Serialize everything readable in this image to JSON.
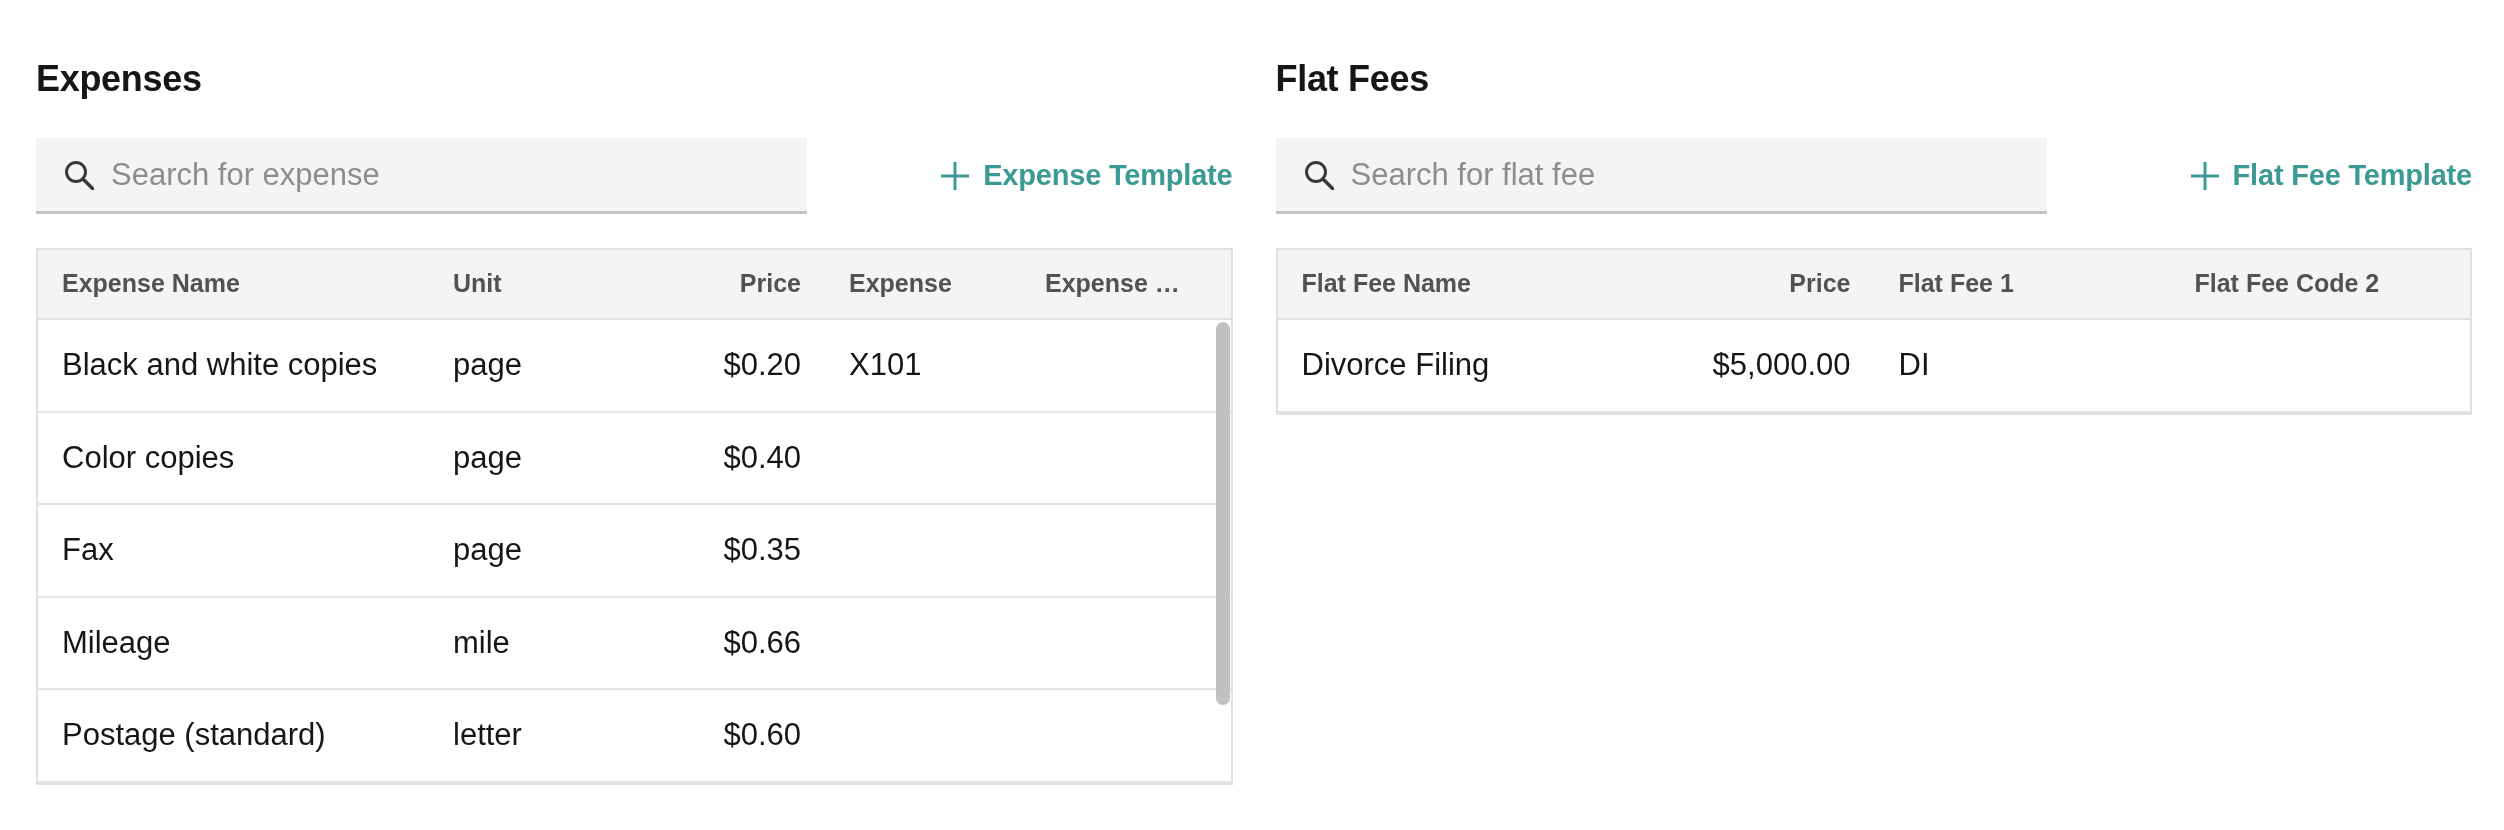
{
  "panels": [
    {
      "title": "Expenses",
      "search": {
        "placeholder": "Search for expense"
      },
      "add_button": {
        "label": "Expense Template"
      },
      "table": {
        "scrollbar": true,
        "columns": [
          {
            "label": "Expense Name",
            "kind": "text"
          },
          {
            "label": "Unit",
            "kind": "text"
          },
          {
            "label": "Price",
            "kind": "amount"
          },
          {
            "label": "Expense",
            "kind": "text"
          },
          {
            "label": "Expense …",
            "kind": "text"
          }
        ],
        "rows": [
          [
            "Black and white copies",
            "page",
            "$0.20",
            "X101"
          ],
          [
            "Color copies",
            "page",
            "$0.40"
          ],
          [
            "Fax",
            "page",
            "$0.35"
          ],
          [
            "Mileage",
            "mile",
            "$0.66"
          ],
          [
            "Postage (standard)",
            "letter",
            "$0.60"
          ]
        ]
      }
    },
    {
      "title": "Flat Fees",
      "search": {
        "placeholder": "Search for flat fee"
      },
      "add_button": {
        "label": "Flat Fee Template"
      },
      "table": {
        "columns": [
          {
            "label": "Flat Fee Name",
            "kind": "text"
          },
          {
            "label": "Price",
            "kind": "amount"
          },
          {
            "label": "Flat Fee 1",
            "kind": "text"
          },
          {
            "label": "Flat Fee Code 2",
            "kind": "text"
          }
        ],
        "rows": [
          [
            "Divorce Filing",
            "$5,000.00",
            "DI"
          ]
        ]
      }
    }
  ]
}
